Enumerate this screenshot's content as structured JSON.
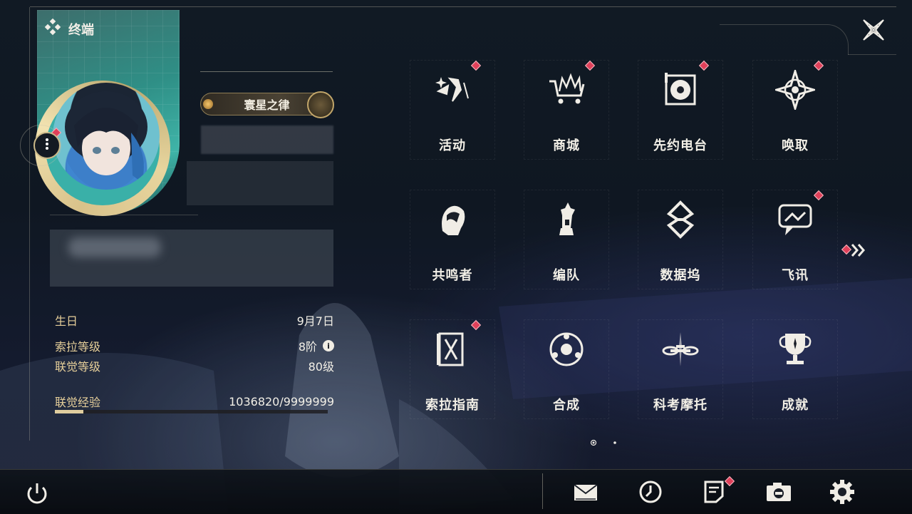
{
  "header": {
    "title": "终端",
    "icon": "diamond-cluster-icon",
    "close_icon": "close-icon"
  },
  "profile": {
    "title_badge": "寰星之律",
    "more_icon": "more-icon",
    "info": [
      {
        "key": "生日",
        "value": "9月7日"
      },
      {
        "key": "索拉等级",
        "value": "8阶",
        "has_info_icon": true,
        "info_symbol": "i"
      },
      {
        "key": "联觉等级",
        "value": "80级"
      },
      {
        "key": "联觉经验",
        "value": "1036820/9999999"
      }
    ],
    "experience": {
      "current": 1036820,
      "max": 9999999,
      "fill_fraction": 0.1037
    }
  },
  "menu": {
    "items": [
      {
        "label": "活动",
        "icon": "activity-sparkle-icon",
        "badge": true
      },
      {
        "label": "商城",
        "icon": "shop-cart-icon",
        "badge": true
      },
      {
        "label": "先约电台",
        "icon": "radio-turntable-icon",
        "badge": true
      },
      {
        "label": "唤取",
        "icon": "summon-compass-icon",
        "badge": true
      },
      {
        "label": "共鸣者",
        "icon": "resonator-portrait-icon",
        "badge": false
      },
      {
        "label": "编队",
        "icon": "team-chess-icon",
        "badge": false
      },
      {
        "label": "数据坞",
        "icon": "databank-icon",
        "badge": false
      },
      {
        "label": "飞讯",
        "icon": "message-bubble-icon",
        "badge": true
      },
      {
        "label": "索拉指南",
        "icon": "guide-book-icon",
        "badge": true
      },
      {
        "label": "合成",
        "icon": "synthesis-ring-icon",
        "badge": false
      },
      {
        "label": "科考摩托",
        "icon": "motorcycle-icon",
        "badge": false
      },
      {
        "label": "成就",
        "icon": "trophy-icon",
        "badge": false
      }
    ],
    "next_page_icon": "double-chevron-right-icon",
    "pagination": {
      "current": 1,
      "total": 2
    }
  },
  "bottom_bar": {
    "left": {
      "icon": "power-icon"
    },
    "right": [
      {
        "icon": "mail-icon",
        "badge": false
      },
      {
        "icon": "clock-icon",
        "badge": false
      },
      {
        "icon": "notice-icon",
        "badge": true
      },
      {
        "icon": "camera-icon",
        "badge": false
      },
      {
        "icon": "settings-gear-icon",
        "badge": false
      }
    ]
  },
  "colors": {
    "accent_gold": "#e6cf9a",
    "badge_red": "#e0405a",
    "text": "#f2efe6"
  }
}
